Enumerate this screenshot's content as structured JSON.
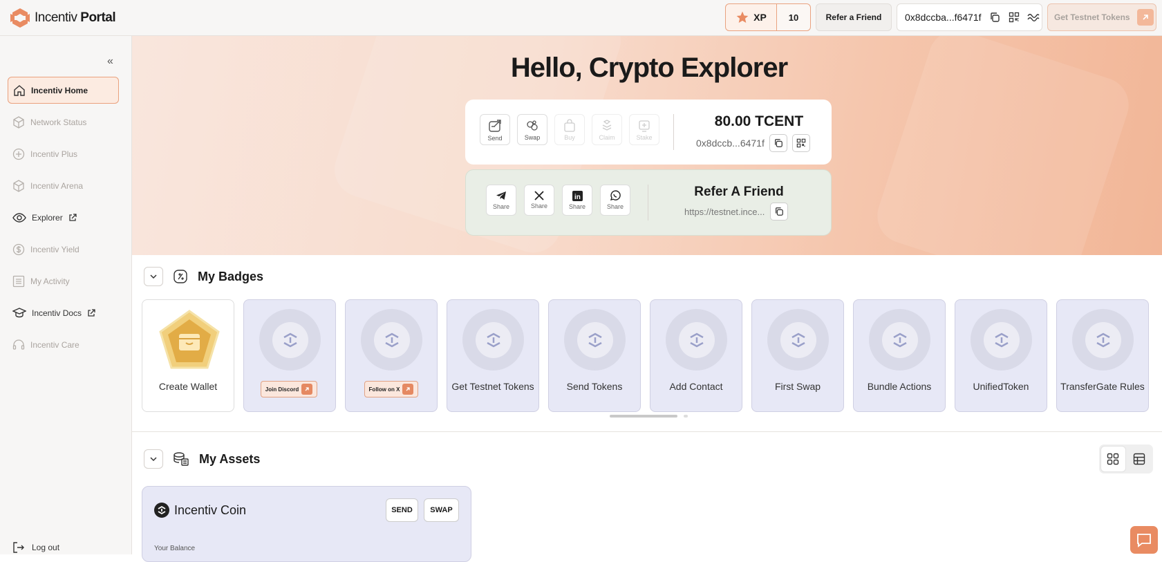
{
  "app": {
    "title_light": "Incentiv",
    "title_bold": "Portal"
  },
  "topbar": {
    "xp_label": "XP",
    "xp_value": "10",
    "refer_label": "Refer a Friend",
    "address": "0x8dccba...f6471f",
    "testnet_label": "Get Testnet Tokens"
  },
  "sidebar": {
    "items": [
      {
        "label": "Incentiv Home",
        "icon": "home-icon",
        "state": "active"
      },
      {
        "label": "Network Status",
        "icon": "cube-icon",
        "state": "disabled"
      },
      {
        "label": "Incentiv Plus",
        "icon": "plus-circle-icon",
        "state": "disabled"
      },
      {
        "label": "Incentiv Arena",
        "icon": "cube-icon",
        "state": "disabled"
      },
      {
        "label": "Explorer",
        "icon": "eye-icon",
        "state": "enabled",
        "external": true
      },
      {
        "label": "Incentiv Yield",
        "icon": "dollar-icon",
        "state": "disabled"
      },
      {
        "label": "My Activity",
        "icon": "list-icon",
        "state": "disabled"
      },
      {
        "label": "Incentiv Docs",
        "icon": "graduation-icon",
        "state": "enabled",
        "external": true
      },
      {
        "label": "Incentiv Care",
        "icon": "headset-icon",
        "state": "disabled"
      }
    ],
    "logout": "Log out"
  },
  "hero": {
    "title": "Hello, Crypto Explorer",
    "wallet": {
      "actions": [
        {
          "label": "Send",
          "icon": "send-icon",
          "enabled": true
        },
        {
          "label": "Swap",
          "icon": "swap-icon",
          "enabled": true
        },
        {
          "label": "Buy",
          "icon": "bag-icon",
          "enabled": false
        },
        {
          "label": "Claim",
          "icon": "claim-icon",
          "enabled": false
        },
        {
          "label": "Stake",
          "icon": "stake-icon",
          "enabled": false
        }
      ],
      "amount": "80.00 TCENT",
      "address": "0x8dccb...6471f"
    },
    "refer": {
      "shares": [
        {
          "label": "Share",
          "icon": "telegram-icon"
        },
        {
          "label": "Share",
          "icon": "x-icon"
        },
        {
          "label": "Share",
          "icon": "linkedin-icon"
        },
        {
          "label": "Share",
          "icon": "whatsapp-icon"
        }
      ],
      "title": "Refer A Friend",
      "link": "https://testnet.ince..."
    }
  },
  "badges": {
    "title": "My Badges",
    "items": [
      {
        "label": "Create Wallet",
        "type": "earned"
      },
      {
        "label": "Join Discord",
        "type": "button"
      },
      {
        "label": "Follow on X",
        "type": "button"
      },
      {
        "label": "Get Testnet Tokens",
        "type": "locked"
      },
      {
        "label": "Send Tokens",
        "type": "locked"
      },
      {
        "label": "Add Contact",
        "type": "locked"
      },
      {
        "label": "First Swap",
        "type": "locked"
      },
      {
        "label": "Bundle Actions",
        "type": "locked"
      },
      {
        "label": "UnifiedToken",
        "type": "locked"
      },
      {
        "label": "TransferGate Rules",
        "type": "locked"
      }
    ]
  },
  "assets": {
    "title": "My Assets",
    "coin_name": "Incentiv Coin",
    "send_label": "SEND",
    "swap_label": "SWAP",
    "balance_label": "Your Balance"
  },
  "colors": {
    "accent": "#e98b62",
    "badge_bg": "#e7e8f6",
    "refer_bg": "#e9eee6"
  }
}
